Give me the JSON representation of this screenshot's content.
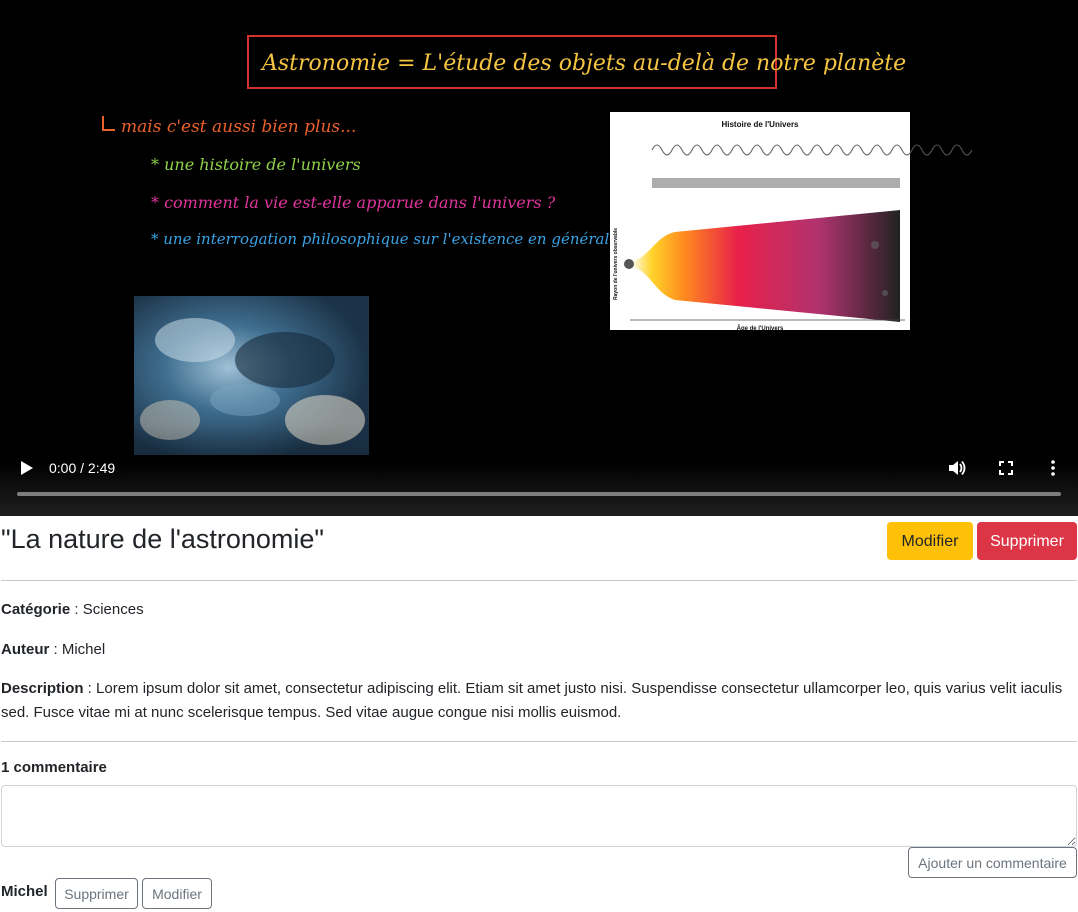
{
  "video": {
    "time_display": "0:00 / 2:49",
    "progress": 0,
    "icons": {
      "play": "play-icon",
      "volume": "volume-icon",
      "fullscreen": "fullscreen-icon",
      "more": "more-vert-icon"
    },
    "slide": {
      "heading": "Astronomie = L'étude des objets au-delà de notre planète",
      "lead": "mais c'est aussi bien plus...",
      "bullets": [
        "* une histoire de l'univers",
        "* comment la vie est-elle apparue dans l'univers ?",
        "* une interrogation philosophique sur l'existence en général"
      ],
      "diagram_title": "Histoire de l'Univers",
      "diagram_xlabel": "Âge de l'Univers",
      "diagram_ylabel": "Rayon de l'univers observable"
    }
  },
  "video_info": {
    "title": "\"La nature de l'astronomie\"",
    "edit_label": "Modifier",
    "delete_label": "Supprimer",
    "category_label": "Catégorie",
    "category_value": "Sciences",
    "author_label": "Auteur",
    "author_value": "Michel",
    "description_label": "Description",
    "description_value": "Lorem ipsum dolor sit amet, consectetur adipiscing elit. Etiam sit amet justo nisi. Suspendisse consectetur ullamcorper leo, quis varius velit iaculis sed. Fusce vitae mi at nunc scelerisque tempus. Sed vitae augue congue nisi mollis euismod."
  },
  "comments": {
    "count_label": "1 commentaire",
    "input_value": "",
    "add_label": "Ajouter un commentaire",
    "items": [
      {
        "author": "Michel",
        "delete_label": "Supprimer",
        "edit_label": "Modifier"
      }
    ]
  },
  "colors": {
    "warning": "#ffc107",
    "danger": "#dc3545",
    "slide_heading_text": "#f5c542",
    "slide_heading_border": "#d8302b",
    "slide_green": "#8fd24a",
    "slide_pink": "#e0359e",
    "slide_blue": "#3aa3e6"
  }
}
